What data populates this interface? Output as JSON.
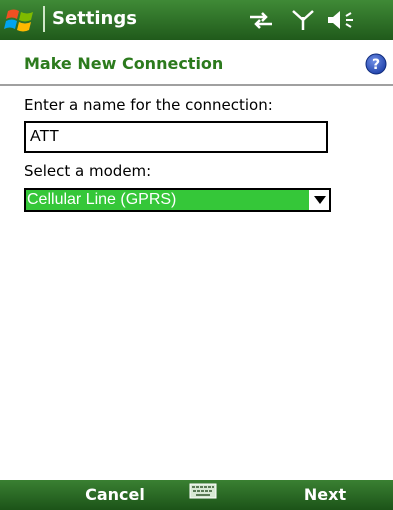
{
  "titlebar": {
    "app_title": "Settings",
    "icons": [
      "windows-start-icon",
      "sync-arrows-icon",
      "signal-antenna-icon",
      "volume-speaker-icon"
    ]
  },
  "page": {
    "title": "Make New Connection",
    "help_icon": "help-icon"
  },
  "form": {
    "name_label": "Enter a name for the connection:",
    "name_value": "ATT",
    "modem_label": "Select a modem:",
    "modem_selected": "Cellular Line (GPRS)"
  },
  "softkeys": {
    "left_label": "Cancel",
    "right_label": "Next",
    "center_icon": "keyboard-icon"
  },
  "colors": {
    "titlebar": "#2c6a25",
    "page_title": "#2c7a1d",
    "selection": "#35c739",
    "softkey_bar": "#235c1d"
  }
}
